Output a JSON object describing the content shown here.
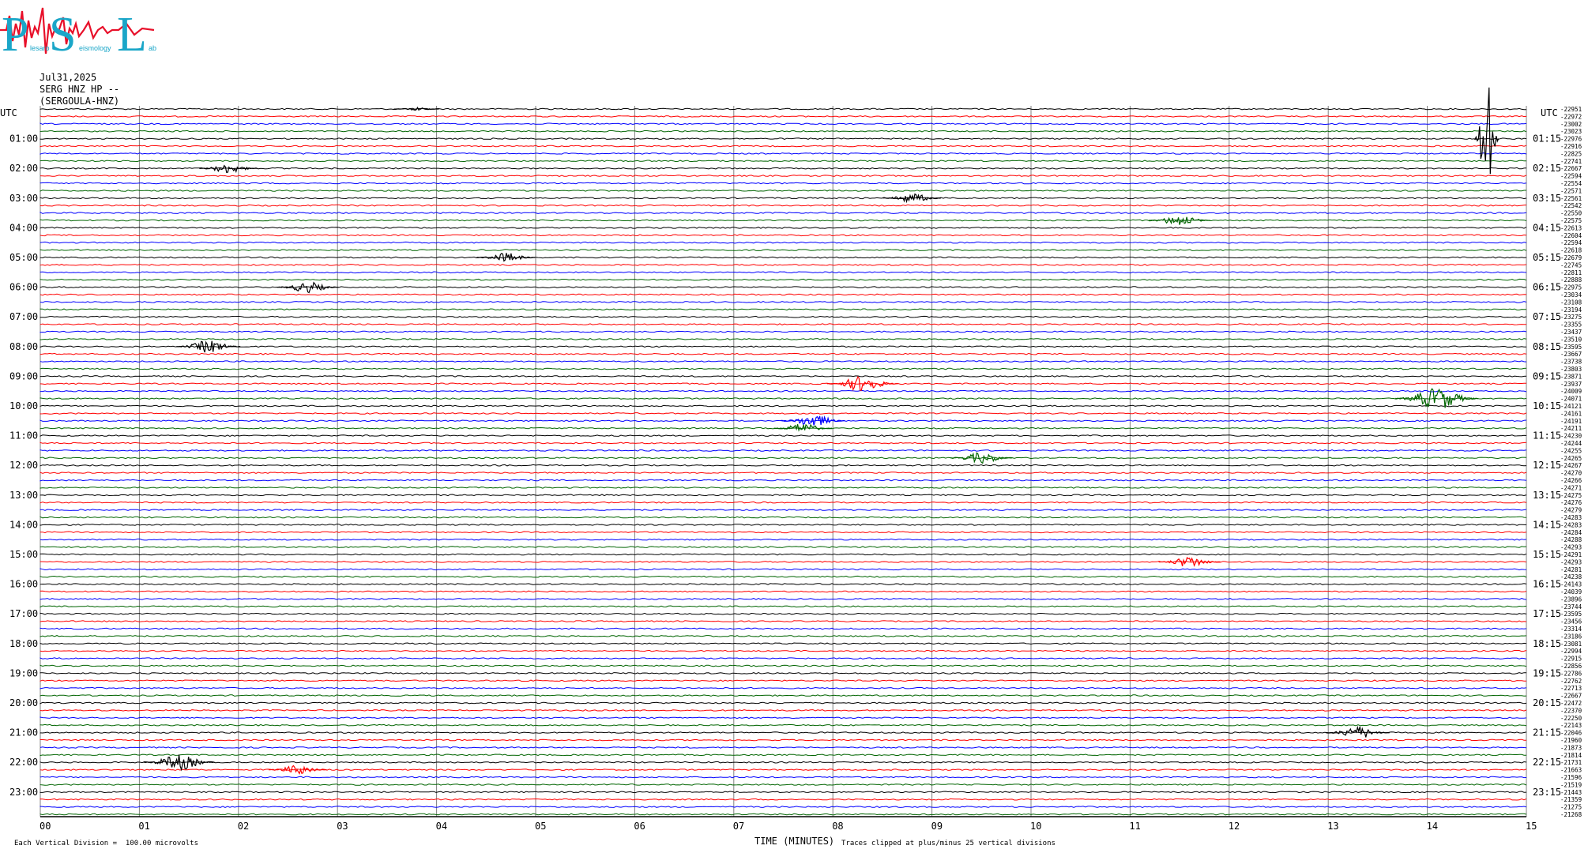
{
  "logo": {
    "letters": [
      "P",
      "S",
      "L"
    ],
    "word_parts": [
      "lesaro",
      "eismology",
      "ab"
    ],
    "text_color": "#1aa6c8",
    "wave_color": "#e8102a"
  },
  "header": {
    "date": "Jul31,2025",
    "station": "SERG HNZ HP --",
    "channel": "(SERGOULA-HNZ)"
  },
  "left_axis_title": "UTC",
  "right_axis_title": "UTC",
  "footer": {
    "scale_note": "Each Vertical Division =  100.00 microvolts",
    "xlabel": "TIME (MINUTES)",
    "clip_note": "Traces clipped at plus/minus 25 vertical divisions"
  },
  "colors": {
    "trace_cycle": [
      "#000000",
      "#ff0000",
      "#0000ff",
      "#006400"
    ],
    "grid": "#808080"
  },
  "chart_data": {
    "type": "line",
    "title": "",
    "xlabel": "TIME (MINUTES)",
    "ylabel": "UTC",
    "xlim": [
      0,
      15
    ],
    "x_ticks": [
      "00",
      "01",
      "02",
      "03",
      "04",
      "05",
      "06",
      "07",
      "08",
      "09",
      "10",
      "11",
      "12",
      "13",
      "14",
      "15"
    ],
    "left_time_labels": [
      "01:00",
      "02:00",
      "03:00",
      "04:00",
      "05:00",
      "06:00",
      "07:00",
      "08:00",
      "09:00",
      "10:00",
      "11:00",
      "12:00",
      "13:00",
      "14:00",
      "15:00",
      "16:00",
      "17:00",
      "18:00",
      "19:00",
      "20:00",
      "21:00",
      "22:00",
      "23:00"
    ],
    "right_time_labels": [
      "01:15",
      "02:15",
      "03:15",
      "04:15",
      "05:15",
      "06:15",
      "07:15",
      "08:15",
      "09:15",
      "10:15",
      "11:15",
      "12:15",
      "13:15",
      "14:15",
      "15:15",
      "16:15",
      "17:15",
      "18:15",
      "19:15",
      "20:15",
      "21:15",
      "22:15",
      "23:15"
    ],
    "trace_count": 96,
    "minutes_per_trace": 15,
    "trace_offsets": [
      -22951,
      -22972,
      -23002,
      -23023,
      -22976,
      -22916,
      -22825,
      -22741,
      -22667,
      -22594,
      -22554,
      -22571,
      -22561,
      -22542,
      -22550,
      -22575,
      -22613,
      -22604,
      -22594,
      -22618,
      -22679,
      -22745,
      -22811,
      -22888,
      -22975,
      -23034,
      -23108,
      -23194,
      -23275,
      -23355,
      -23437,
      -23510,
      -23595,
      -23667,
      -23738,
      -23803,
      -23871,
      -23937,
      -24009,
      -24071,
      -24121,
      -24161,
      -24191,
      -24211,
      -24230,
      -24244,
      -24255,
      -24265,
      -24267,
      -24270,
      -24266,
      -24271,
      -24275,
      -24276,
      -24279,
      -24283,
      -24283,
      -24284,
      -24288,
      -24293,
      -24291,
      -24293,
      -24281,
      -24238,
      -24143,
      -24039,
      -23896,
      -23744,
      -23595,
      -23456,
      -23314,
      -23186,
      -23081,
      -22994,
      -22915,
      -22856,
      -22786,
      -22762,
      -22713,
      -22667,
      -22472,
      -22370,
      -22250,
      -22143,
      -22046,
      -21960,
      -21873,
      -21814,
      -21731,
      -21663,
      -21596,
      -21519,
      -21443,
      -21359,
      -21275,
      -21268
    ],
    "events": [
      {
        "trace": 0,
        "minute": 3.8,
        "amplitude": 2
      },
      {
        "trace": 4,
        "minute": 14.6,
        "amplitude": 95
      },
      {
        "trace": 8,
        "minute": 1.9,
        "amplitude": 6
      },
      {
        "trace": 12,
        "minute": 8.8,
        "amplitude": 6
      },
      {
        "trace": 15,
        "minute": 11.5,
        "amplitude": 7
      },
      {
        "trace": 20,
        "minute": 4.7,
        "amplitude": 6
      },
      {
        "trace": 24,
        "minute": 2.7,
        "amplitude": 7
      },
      {
        "trace": 32,
        "minute": 1.7,
        "amplitude": 8
      },
      {
        "trace": 37,
        "minute": 8.3,
        "amplitude": 10
      },
      {
        "trace": 39,
        "minute": 14.1,
        "amplitude": 14
      },
      {
        "trace": 42,
        "minute": 7.8,
        "amplitude": 8
      },
      {
        "trace": 43,
        "minute": 7.7,
        "amplitude": 6
      },
      {
        "trace": 47,
        "minute": 9.5,
        "amplitude": 7
      },
      {
        "trace": 61,
        "minute": 11.6,
        "amplitude": 7
      },
      {
        "trace": 84,
        "minute": 13.3,
        "amplitude": 8
      },
      {
        "trace": 88,
        "minute": 1.4,
        "amplitude": 10
      },
      {
        "trace": 89,
        "minute": 2.6,
        "amplitude": 6
      }
    ]
  }
}
